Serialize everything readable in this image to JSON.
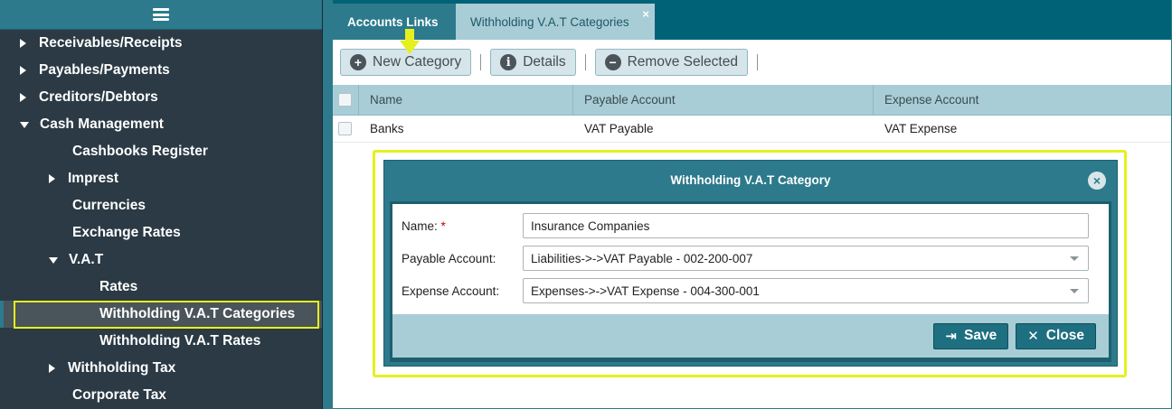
{
  "sidebar": {
    "menu_icon": "hamburger-icon",
    "items": [
      {
        "label": "Receivables/Receipts",
        "level": 0,
        "state": "collapsed"
      },
      {
        "label": "Payables/Payments",
        "level": 0,
        "state": "collapsed"
      },
      {
        "label": "Creditors/Debtors",
        "level": 0,
        "state": "collapsed"
      },
      {
        "label": "Cash Management",
        "level": 0,
        "state": "expanded"
      },
      {
        "label": "Cashbooks Register",
        "level": 1,
        "state": "leaf"
      },
      {
        "label": "Imprest",
        "level": 1,
        "state": "collapsed"
      },
      {
        "label": "Currencies",
        "level": 1,
        "state": "leaf"
      },
      {
        "label": "Exchange Rates",
        "level": 1,
        "state": "leaf"
      },
      {
        "label": "V.A.T",
        "level": 1,
        "state": "expanded"
      },
      {
        "label": "Rates",
        "level": 2,
        "state": "leaf"
      },
      {
        "label": "Withholding V.A.T Categories",
        "level": 2,
        "state": "leaf",
        "selected": true
      },
      {
        "label": "Withholding V.A.T Rates",
        "level": 2,
        "state": "leaf"
      },
      {
        "label": "Withholding Tax",
        "level": 1,
        "state": "collapsed"
      },
      {
        "label": "Corporate Tax",
        "level": 1,
        "state": "leaf"
      }
    ]
  },
  "tabs": [
    {
      "label": "Accounts Links",
      "active": false
    },
    {
      "label": "Withholding V.A.T Categories",
      "active": true,
      "close": "×"
    }
  ],
  "toolbar": {
    "new_label": "New Category",
    "details_label": "Details",
    "remove_label": "Remove Selected"
  },
  "grid": {
    "columns": [
      "Name",
      "Payable Account",
      "Expense Account"
    ],
    "rows": [
      {
        "name": "Banks",
        "payable": "VAT Payable",
        "expense": "VAT Expense"
      }
    ]
  },
  "dialog": {
    "title": "Withholding V.A.T Category",
    "fields": {
      "name_label": "Name:",
      "name_required": "*",
      "name_value": "Insurance Companies",
      "payable_label": "Payable Account:",
      "payable_value": "Liabilities->->VAT Payable - 002-200-007",
      "expense_label": "Expense Account:",
      "expense_value": "Expenses->->VAT Expense - 004-300-001"
    },
    "save_label": "Save",
    "close_label": "Close"
  },
  "colors": {
    "accent": "#2c7a8c",
    "highlight": "#e6f01e",
    "sidebar_bg": "#2b3a44"
  }
}
